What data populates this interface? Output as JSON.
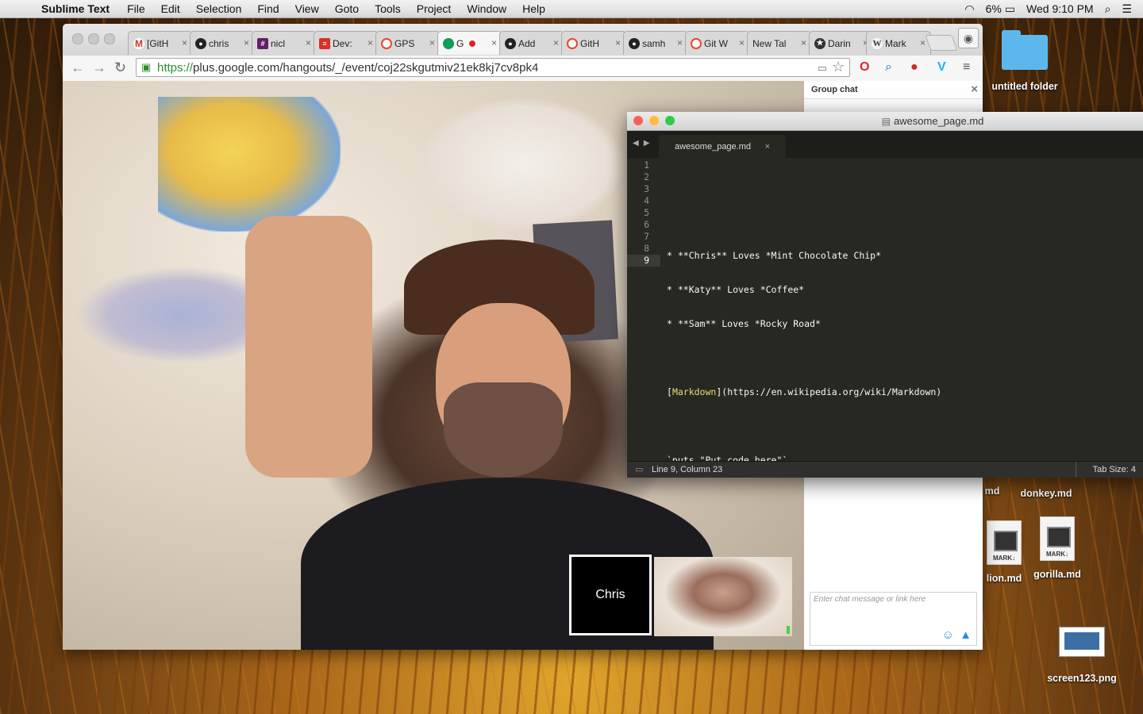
{
  "menubar": {
    "app_name": "Sublime Text",
    "menus": [
      "File",
      "Edit",
      "Selection",
      "Find",
      "View",
      "Goto",
      "Tools",
      "Project",
      "Window",
      "Help"
    ],
    "battery": "6%",
    "clock": "Wed 9:10 PM",
    "icons": [
      "apple-icon",
      "wifi-icon",
      "battery-icon",
      "spotlight-icon",
      "notification-center-icon"
    ]
  },
  "browser": {
    "tabs": [
      {
        "title": "[GitH",
        "icon": "gmail-icon",
        "color": "#d93025"
      },
      {
        "title": "chris",
        "icon": "github-icon",
        "color": "#222222"
      },
      {
        "title": "nicl",
        "icon": "slack-icon",
        "color": "#611f69"
      },
      {
        "title": "Dev:",
        "icon": "dev-icon",
        "color": "#d93025"
      },
      {
        "title": "GPS",
        "icon": "gps-icon",
        "color": "#e8452c"
      },
      {
        "title": "G",
        "icon": "hangouts-icon",
        "color": "#0f9d58"
      },
      {
        "title": "Add",
        "icon": "github-icon",
        "color": "#222222"
      },
      {
        "title": "GitH",
        "icon": "gps-icon",
        "color": "#e8452c"
      },
      {
        "title": "samh",
        "icon": "github-icon",
        "color": "#222222"
      },
      {
        "title": "Git W",
        "icon": "gps-icon",
        "color": "#e8452c"
      },
      {
        "title": "New Tal",
        "icon": "",
        "color": "#f6f6f6"
      },
      {
        "title": "Darin",
        "icon": "star-icon",
        "color": "#333333"
      },
      {
        "title": "Mark",
        "icon": "wikipedia-icon",
        "color": "#333333"
      }
    ],
    "url_scheme": "https://",
    "url_rest": "plus.google.com/hangouts/_/event/coj22skgutmiv21ek8kj7cv8pk4",
    "extensions": [
      "opera-icon",
      "search-extension-icon",
      "tomato-icon",
      "vimeo-icon",
      "menu-icon"
    ]
  },
  "hangout": {
    "participant_label": "Chris",
    "chat": {
      "title": "Group chat",
      "placeholder": "Enter chat message or link here"
    }
  },
  "editor": {
    "window_title": "awesome_page.md",
    "tab_name": "awesome_page.md",
    "lines": [
      "",
      "",
      "* **Chris** Loves *Mint Chocolate Chip*",
      "* **Katy** Loves *Coffee*",
      "* **Sam** Loves *Rocky Road*",
      "",
      "[Markdown](https://en.wikipedia.org/wiki/Markdown)",
      "",
      "`puts \"Put code here\"`"
    ],
    "line_numbers": [
      "1",
      "2",
      "3",
      "4",
      "5",
      "6",
      "7",
      "8",
      "9"
    ],
    "link_text": "Markdown",
    "link_rest": "(https://en.wikipedia.org/wiki/Markdown)",
    "line7_open": "[",
    "line7_close": "]",
    "status_position": "Line 9, Column 23",
    "status_tab_size": "Tab Size: 4"
  },
  "desktop": {
    "folder_label": "untitled folder",
    "partial_label": "md",
    "files": [
      {
        "name": "donkey.md"
      },
      {
        "name": "lion.md",
        "badge": "MARK↓"
      },
      {
        "name": "gorilla.md",
        "badge": "MARK↓"
      },
      {
        "name": "screen123.png"
      }
    ]
  },
  "colors": {
    "sublime_bg": "#272822",
    "sublime_link": "#e6db74",
    "chrome_green": "#2c8e2c"
  }
}
